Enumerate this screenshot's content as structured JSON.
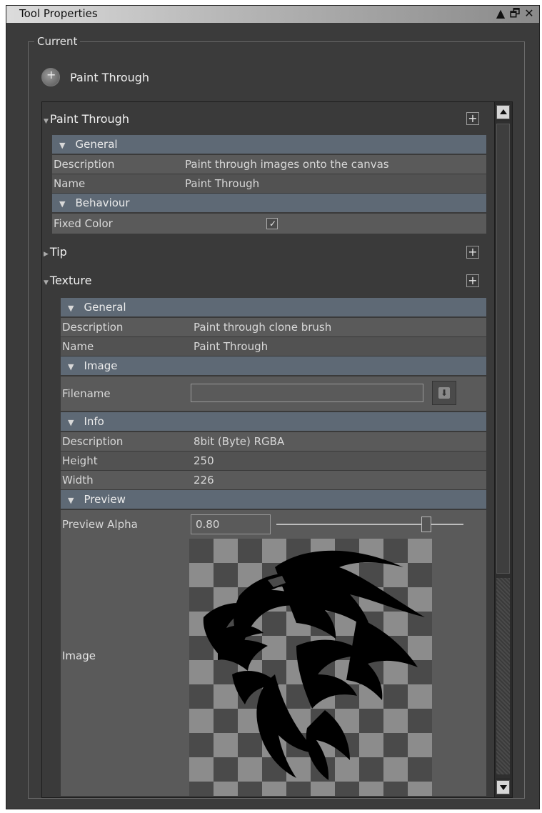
{
  "window": {
    "title": "Tool Properties",
    "buttons": [
      "▲",
      "🗗",
      "✕"
    ]
  },
  "current": {
    "group_label": "Current",
    "tool_name": "Paint Through",
    "tool_icon": "paint-through-icon"
  },
  "tree": {
    "root": {
      "label": "Paint Through",
      "general": {
        "label": "General",
        "rows": [
          {
            "key": "Description",
            "value": "Paint through images onto the canvas"
          },
          {
            "key": "Name",
            "value": "Paint Through"
          }
        ]
      },
      "behaviour": {
        "label": "Behaviour",
        "fixed_color_label": "Fixed Color",
        "fixed_color_checked": true
      }
    },
    "tip": {
      "label": "Tip"
    },
    "texture": {
      "label": "Texture",
      "general": {
        "label": "General",
        "rows": [
          {
            "key": "Description",
            "value": "Paint through clone brush"
          },
          {
            "key": "Name",
            "value": "Paint Through"
          }
        ]
      },
      "image": {
        "label": "Image",
        "filename_label": "Filename",
        "filename_value": ""
      },
      "info": {
        "label": "Info",
        "rows": [
          {
            "key": "Description",
            "value": "8bit  (Byte) RGBA"
          },
          {
            "key": "Height",
            "value": "250"
          },
          {
            "key": "Width",
            "value": "226"
          }
        ]
      },
      "preview": {
        "label": "Preview",
        "alpha_label": "Preview Alpha",
        "alpha_value": "0.80",
        "alpha_fraction": 0.8,
        "image_label": "Image"
      }
    }
  },
  "colors": {
    "panel_bg": "#3b3b3b",
    "section_band": "#5e6975",
    "row_bg": "#5a5a5a"
  }
}
